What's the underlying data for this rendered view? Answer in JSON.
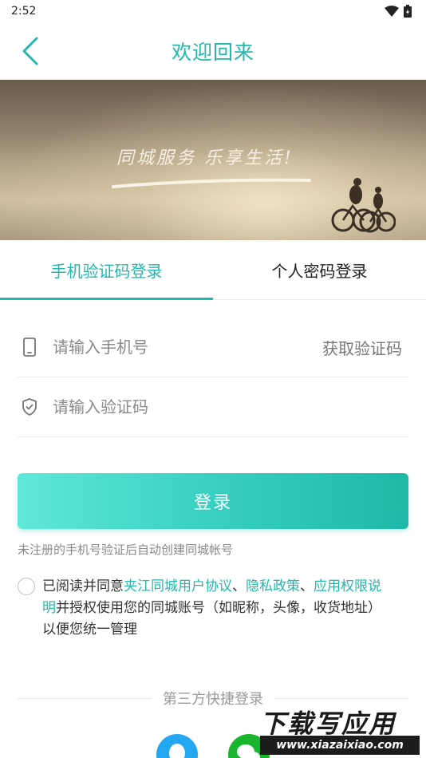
{
  "status_bar": {
    "time": "2:52"
  },
  "header": {
    "title": "欢迎回来"
  },
  "banner": {
    "slogan": "同城服务 乐享生活!"
  },
  "tabs": [
    {
      "label": "手机验证码登录",
      "active": true
    },
    {
      "label": "个人密码登录",
      "active": false
    }
  ],
  "form": {
    "phone_placeholder": "请输入手机号",
    "get_code_label": "获取验证码",
    "code_placeholder": "请输入验证码"
  },
  "login_button": "登录",
  "hint": "未注册的手机号验证后自动创建同城帐号",
  "agreement": {
    "prefix": "已阅读并同意",
    "link_user_agreement": "夹江同城用户协议",
    "sep1": "、",
    "link_privacy": "隐私政策",
    "sep2": "、",
    "link_permissions": "应用权限说明",
    "suffix": "并授权使用您的同城账号（如昵称，头像，收货地址）以便您统一管理"
  },
  "third_party": {
    "label": "第三方快捷登录"
  },
  "watermark": {
    "title": "下载写应用",
    "url": "www.xiazaixiao.com"
  },
  "colors": {
    "accent": "#22b8ad",
    "button_start": "#5fe8d8",
    "button_end": "#1cbaa6"
  }
}
